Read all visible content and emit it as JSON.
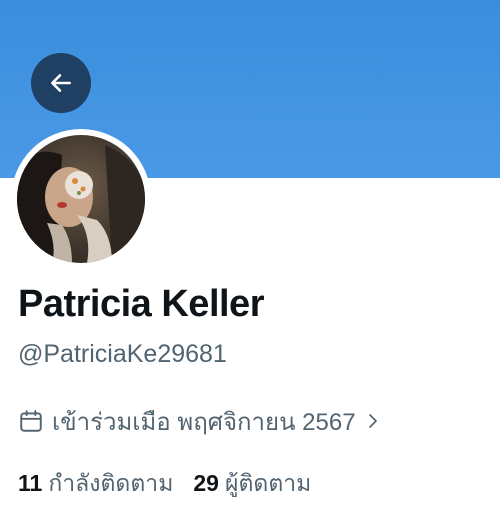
{
  "profile": {
    "name": "Patricia Keller",
    "handle": "@PatriciaKe29681",
    "joined": "เข้าร่วมเมือ พฤศจิกายน 2567"
  },
  "stats": {
    "following_count": "11",
    "following_label": "กำลังติดตาม",
    "followers_count": "29",
    "followers_label": "ผู้ติดตาม"
  },
  "icons": {
    "back": "arrow-left-icon",
    "calendar": "calendar-icon",
    "chevron": "chevron-right-icon"
  },
  "colors": {
    "banner": "#4a99e6",
    "back_button": "#1f3f63",
    "text_primary": "#0f1419",
    "text_secondary": "#536471"
  }
}
